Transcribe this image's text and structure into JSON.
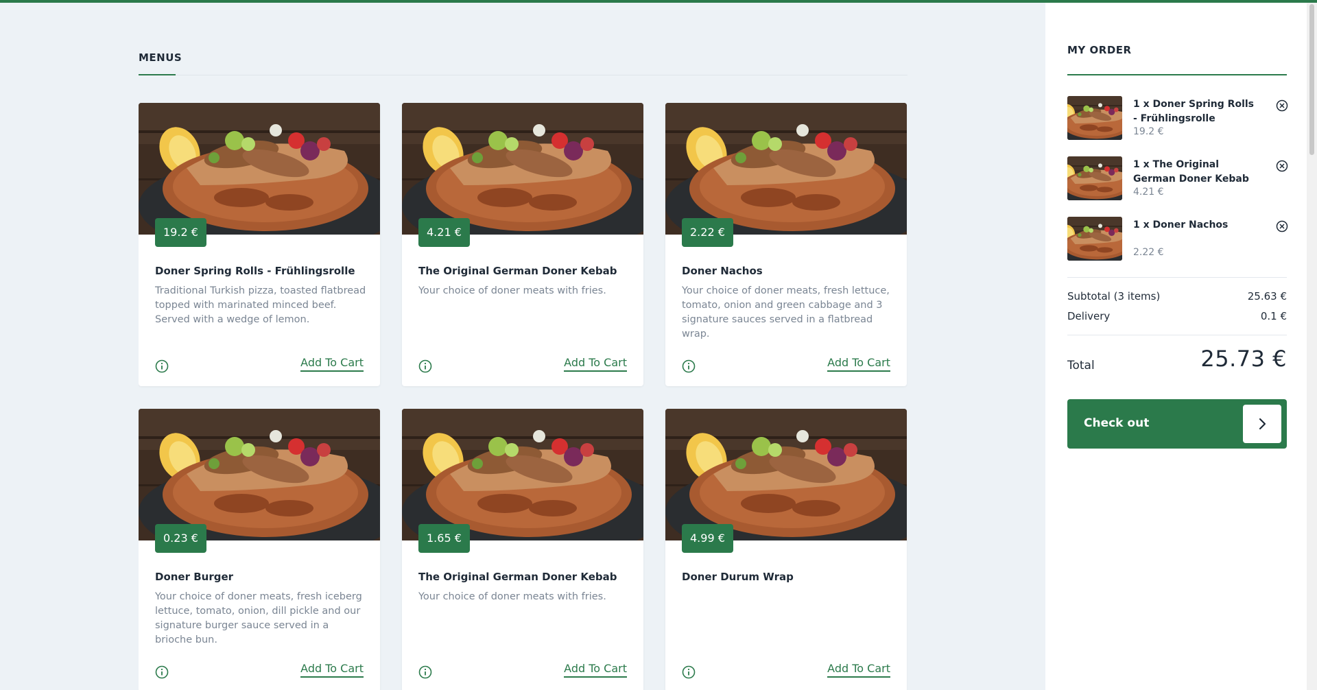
{
  "colors": {
    "accent": "#2b7a4b",
    "background": "#edf2f6",
    "muted_text": "#7a8593"
  },
  "menus": {
    "title": "MENUS",
    "items": [
      {
        "price": "19.2 €",
        "title": "Doner Spring Rolls - Frühlingsrolle",
        "description": "Traditional Turkish pizza, toasted flatbread topped with marinated minced beef. Served with a wedge of lemon.",
        "add_label": "Add To Cart"
      },
      {
        "price": "4.21 €",
        "title": "The Original German Doner Kebab",
        "description": "Your choice of doner meats with fries.",
        "add_label": "Add To Cart"
      },
      {
        "price": "2.22 €",
        "title": "Doner Nachos",
        "description": "Your choice of doner meats, fresh lettuce, tomato, onion and green cabbage and 3 signature sauces served in a flatbread wrap.",
        "add_label": "Add To Cart"
      },
      {
        "price": "0.23 €",
        "title": "Doner Burger",
        "description": "Your choice of doner meats, fresh iceberg lettuce, tomato, onion, dill pickle and our signature burger sauce served in a brioche bun.",
        "add_label": "Add To Cart"
      },
      {
        "price": "1.65 €",
        "title": "The Original German Doner Kebab",
        "description": "Your choice of doner meats with fries.",
        "add_label": "Add To Cart"
      },
      {
        "price": "4.99 €",
        "title": "Doner Durum Wrap",
        "description": "",
        "add_label": "Add To Cart"
      }
    ]
  },
  "order": {
    "title": "MY ORDER",
    "items": [
      {
        "name": "1 x Doner Spring Rolls - Frühlingsrolle",
        "price": "19.2 €"
      },
      {
        "name": "1 x The Original German Doner Kebab",
        "price": "4.21 €"
      },
      {
        "name": "1 x Doner Nachos",
        "price": "2.22 €"
      }
    ],
    "subtotal_label": "Subtotal (3 items)",
    "subtotal_value": "25.63 €",
    "delivery_label": "Delivery",
    "delivery_value": "0.1 €",
    "total_label": "Total",
    "total_value": "25.73 €",
    "checkout_label": "Check out"
  }
}
